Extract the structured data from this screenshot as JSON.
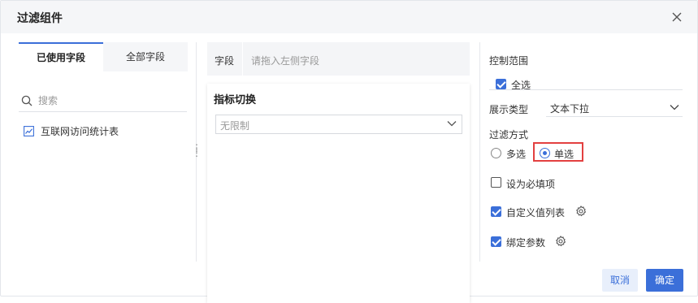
{
  "dialog": {
    "title": "过滤组件"
  },
  "left_panel": {
    "tabs": [
      {
        "label": "已使用字段"
      },
      {
        "label": "全部字段"
      }
    ],
    "search_placeholder": "搜索",
    "items": [
      {
        "label": "互联网访问统计表",
        "icon": "line-chart-icon"
      }
    ]
  },
  "middle_panel": {
    "field_label": "字段",
    "drop_placeholder": "请拖入左侧字段",
    "card_title": "指标切换",
    "select_value": "无限制"
  },
  "right_panel": {
    "control_range_label": "控制范围",
    "select_all_label": "全选",
    "select_all_checked": true,
    "display_type_label": "展示类型",
    "display_type_value": "文本下拉",
    "filter_mode_label": "过滤方式",
    "multi_label": "多选",
    "single_label": "单选",
    "selected_mode": "单选",
    "required_label": "设为必填项",
    "required_checked": false,
    "custom_values_label": "自定义值列表",
    "custom_values_checked": true,
    "bind_params_label": "绑定参数",
    "bind_params_checked": true
  },
  "footer": {
    "cancel_label": "取消",
    "ok_label": "确定"
  },
  "colors": {
    "accent": "#3b6fd9",
    "highlight_border": "#e34040"
  }
}
